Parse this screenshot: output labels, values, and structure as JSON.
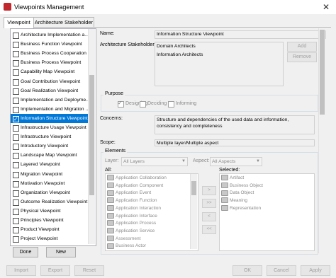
{
  "window": {
    "title": "Viewpoints Management"
  },
  "tabs": [
    "Viewpoint",
    "Architecture Stakeholder"
  ],
  "viewpoints": [
    "Architecture Implementation a...",
    "Business Function Viewpoint",
    "Business Process Cooperation ...",
    "Business Process Viewpoint",
    "Capability Map Viewpoint",
    "Goal Contribution Viewpoint",
    "Goal Realization Viewpoint",
    "Implementation and Deployme...",
    "Implementation and Migration ...",
    "Information Structure Viewpoint",
    "Infrastructure Usage Viewpoint",
    "Infrastructure Viewpoint",
    "Introductory Viewpoint",
    "Landscape Map Viewpoint",
    "Layered Viewpoint",
    "Migration Viewpoint",
    "Motivation Viewpoint",
    "Organization Viewpoint",
    "Outcome Realization Viewpoint",
    "Physical Viewpoint",
    "Principles Viewpoint",
    "Product Viewpoint",
    "Project Viewpoint"
  ],
  "selected_index": 9,
  "left_buttons": {
    "done": "Done",
    "new": "New"
  },
  "form": {
    "name_label": "Name:",
    "name_value": "Information Structure Viewpoint",
    "stakeholders_label": "Architecture Stakeholders:",
    "stakeholders": [
      "Domain Architects",
      "Information Architects"
    ],
    "add": "Add",
    "remove": "Remove",
    "purpose_label": "Purpose",
    "purposes": [
      {
        "label": "Designing",
        "checked": true
      },
      {
        "label": "Deciding",
        "checked": false
      },
      {
        "label": "Informing",
        "checked": false
      }
    ],
    "concerns_label": "Concerns:",
    "concerns_value": "Structure and dependencies of the used data and information, consistency and completeness",
    "scope_label": "Scope:",
    "scope_value": "Multiple layer/Multiple aspect"
  },
  "elements": {
    "label": "Elements",
    "layer_label": "Layer:",
    "layer_value": "All Layers",
    "aspect_label": "Aspect:",
    "aspect_value": "All Aspects",
    "all_label": "All:",
    "selected_label": "Selected:",
    "all": [
      "Application Collaboration",
      "Application Component",
      "Application Event",
      "Application Function",
      "Application Interaction",
      "Application Interface",
      "Application Process",
      "Application Service",
      "Assessment",
      "Business Actor"
    ],
    "selected": [
      "Artifact",
      "Business Object",
      "Data Object",
      "Meaning",
      "Representation"
    ],
    "transfer_buttons": [
      ">",
      ">>",
      "<",
      "<<"
    ]
  },
  "bottom_buttons": {
    "import": "Import",
    "export": "Export",
    "reset": "Reset",
    "ok": "OK",
    "cancel": "Cancel",
    "apply": "Apply"
  }
}
